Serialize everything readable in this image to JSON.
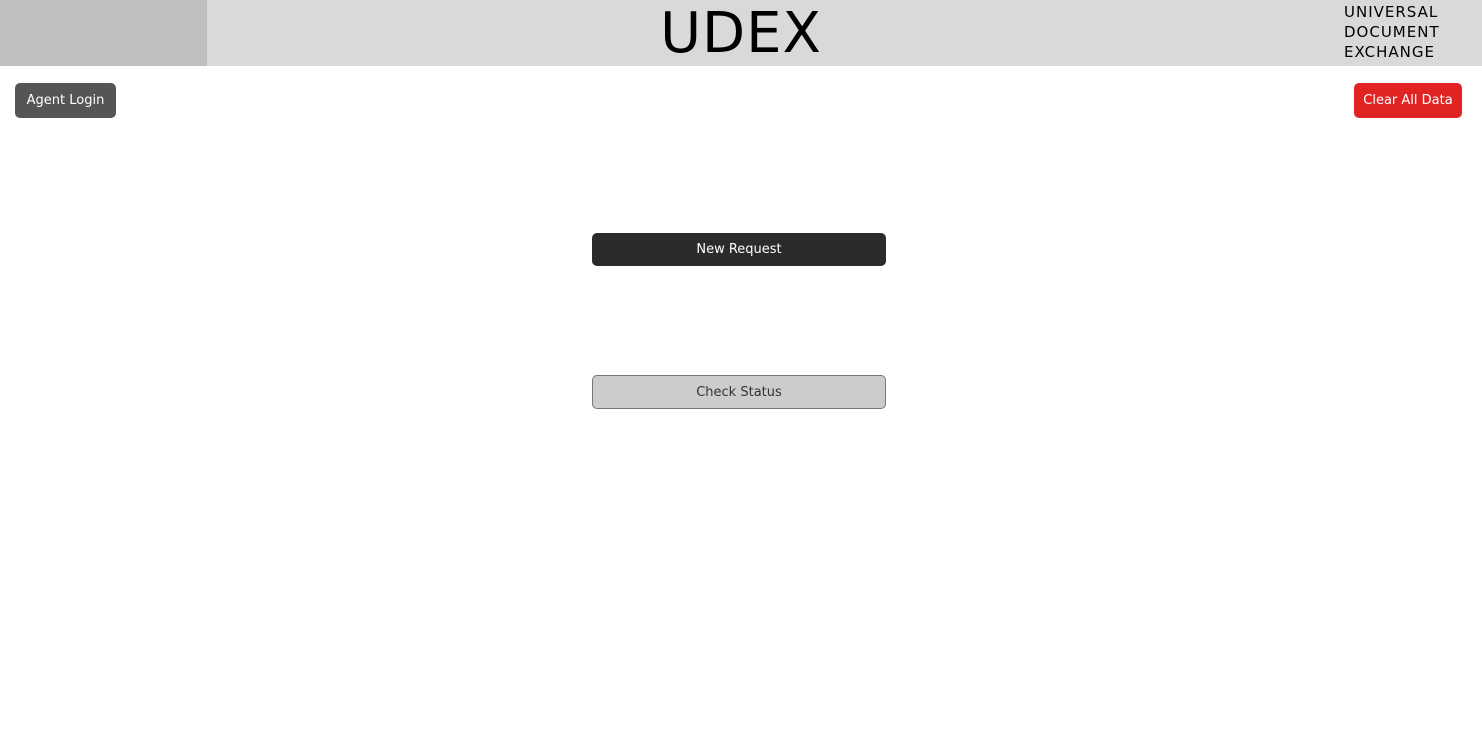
{
  "header": {
    "title": "UDEX",
    "tagline": [
      "UNIVERSAL",
      "DOCUMENT",
      "EXCHANGE"
    ]
  },
  "toolbar": {
    "agent_login_label": "Agent Login",
    "clear_all_label": "Clear All Data"
  },
  "main": {
    "new_request_label": "New Request",
    "check_status_label": "Check Status"
  },
  "colors": {
    "header_bg": "#d9d9d9",
    "header_left_block": "#bfbfbf",
    "agent_login_bg": "#555555",
    "clear_all_bg": "#e02424",
    "new_request_bg": "#2b2b2b",
    "check_status_bg": "#cccccc"
  }
}
